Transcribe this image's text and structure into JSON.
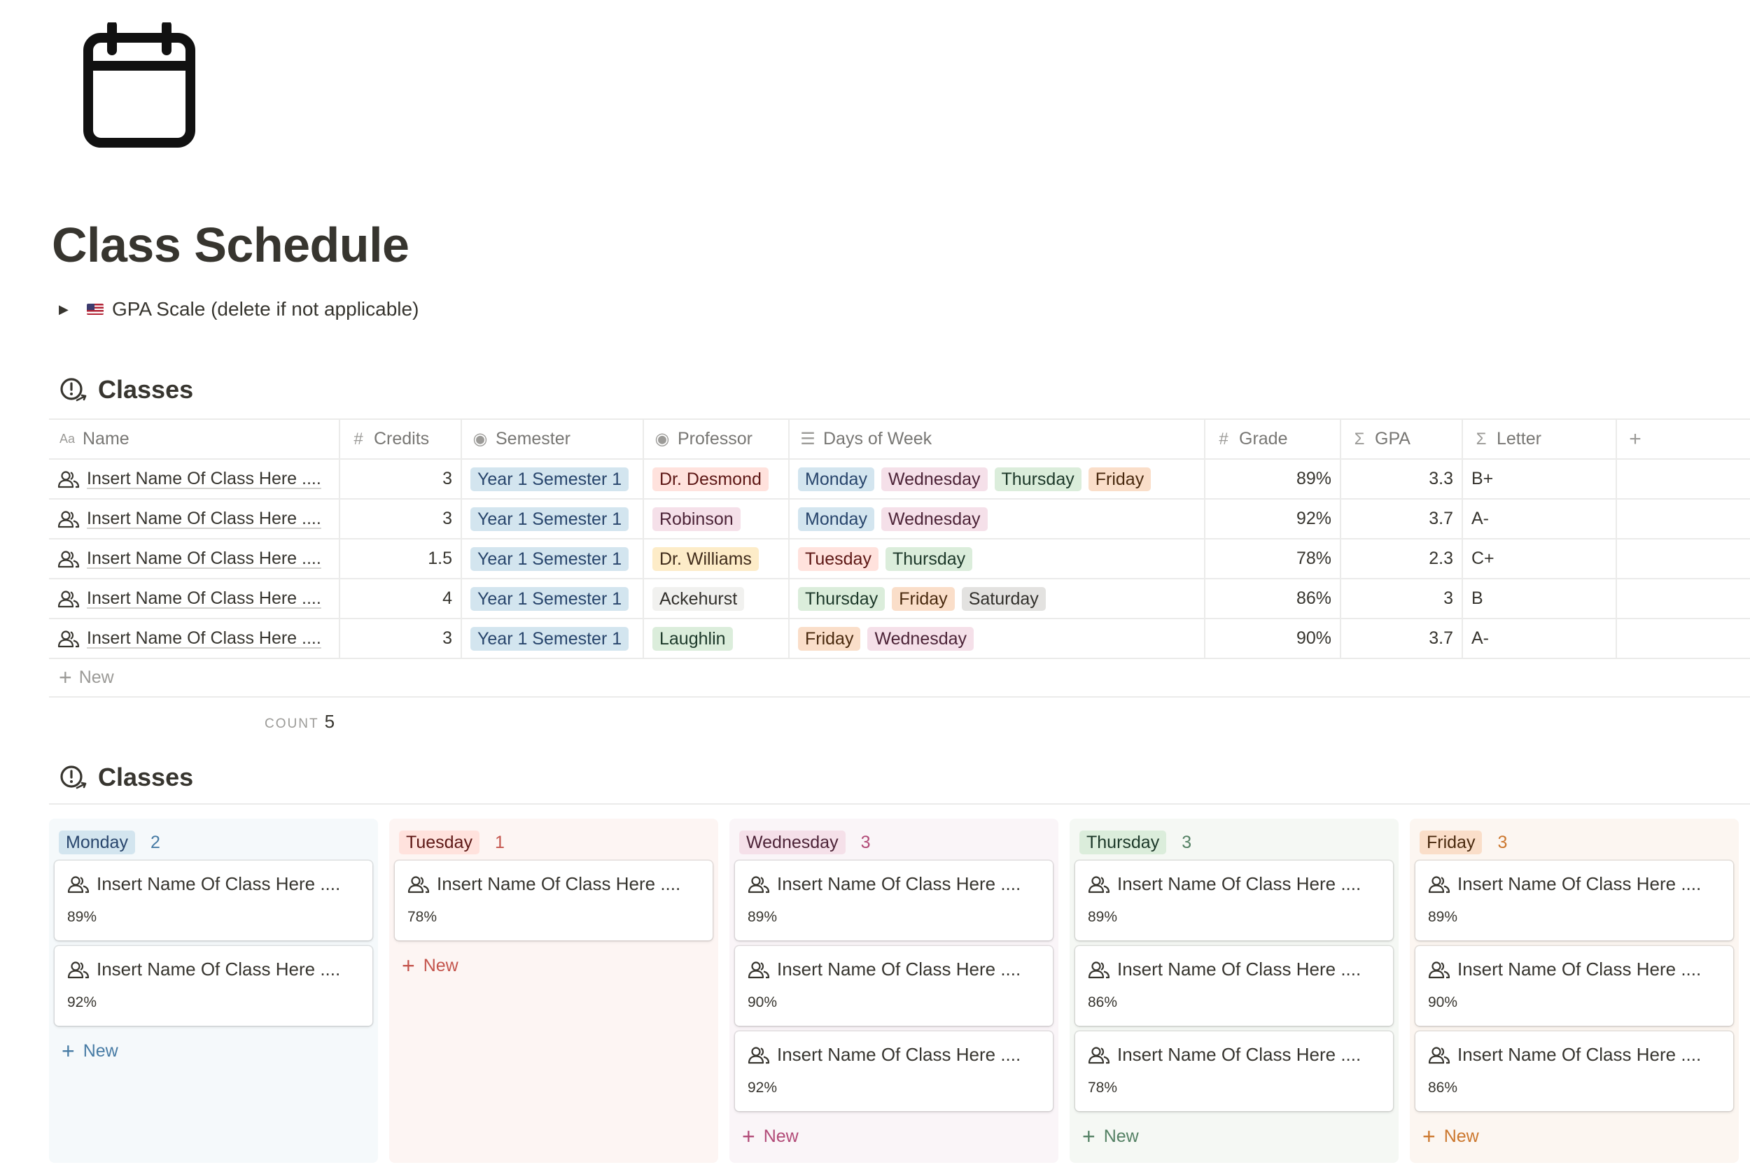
{
  "page": {
    "icon": "calendar-icon",
    "title": "Class Schedule",
    "toggle_label": "GPA Scale (delete if not applicable)"
  },
  "colors": {
    "blue_tag": "#d3e5ef",
    "red_tag": "#ffe2dd",
    "pink_tag": "#f5e0e9",
    "green_tag": "#dbeddb",
    "orange_tag": "#fadec9",
    "yellow_tag": "#fdecc8",
    "gray_tag": "#e3e2e0",
    "default_tag": "#f1f1ef"
  },
  "table": {
    "title": "Classes",
    "headers": {
      "name": "Name",
      "credits": "Credits",
      "semester": "Semester",
      "professor": "Professor",
      "days": "Days of Week",
      "grade": "Grade",
      "gpa": "GPA",
      "letter": "Letter"
    },
    "rows": [
      {
        "name": "Insert Name Of Class Here ....",
        "credits": "3",
        "semester": "Year 1 Semester 1",
        "professor": "Dr. Desmond",
        "days": [
          "Monday",
          "Wednesday",
          "Thursday",
          "Friday"
        ],
        "grade": "89%",
        "gpa": "3.3",
        "letter": "B+"
      },
      {
        "name": "Insert Name Of Class Here ....",
        "credits": "3",
        "semester": "Year 1 Semester 1",
        "professor": "Robinson",
        "days": [
          "Monday",
          "Wednesday"
        ],
        "grade": "92%",
        "gpa": "3.7",
        "letter": "A-"
      },
      {
        "name": "Insert Name Of Class Here ....",
        "credits": "1.5",
        "semester": "Year 1 Semester 1",
        "professor": "Dr. Williams",
        "days": [
          "Tuesday",
          "Thursday"
        ],
        "grade": "78%",
        "gpa": "2.3",
        "letter": "C+"
      },
      {
        "name": "Insert Name Of Class Here ....",
        "credits": "4",
        "semester": "Year 1 Semester 1",
        "professor": "Ackehurst",
        "days": [
          "Thursday",
          "Friday",
          "Saturday"
        ],
        "grade": "86%",
        "gpa": "3",
        "letter": "B"
      },
      {
        "name": "Insert Name Of Class Here ....",
        "credits": "3",
        "semester": "Year 1 Semester 1",
        "professor": "Laughlin",
        "days": [
          "Friday",
          "Wednesday"
        ],
        "grade": "90%",
        "gpa": "3.7",
        "letter": "A-"
      }
    ],
    "new_label": "New",
    "count_label": "COUNT",
    "count_value": "5"
  },
  "board": {
    "title": "Classes",
    "columns": [
      {
        "label": "Monday",
        "count": "2",
        "cards": [
          {
            "name": "Insert Name Of Class Here ....",
            "grade": "89%"
          },
          {
            "name": "Insert Name Of Class Here ....",
            "grade": "92%"
          }
        ],
        "new_label": "New"
      },
      {
        "label": "Tuesday",
        "count": "1",
        "cards": [
          {
            "name": "Insert Name Of Class Here ....",
            "grade": "78%"
          }
        ],
        "new_label": "New"
      },
      {
        "label": "Wednesday",
        "count": "3",
        "cards": [
          {
            "name": "Insert Name Of Class Here ....",
            "grade": "89%"
          },
          {
            "name": "Insert Name Of Class Here ....",
            "grade": "90%"
          },
          {
            "name": "Insert Name Of Class Here ....",
            "grade": "92%"
          }
        ],
        "new_label": "New"
      },
      {
        "label": "Thursday",
        "count": "3",
        "cards": [
          {
            "name": "Insert Name Of Class Here ....",
            "grade": "89%"
          },
          {
            "name": "Insert Name Of Class Here ....",
            "grade": "86%"
          },
          {
            "name": "Insert Name Of Class Here ....",
            "grade": "78%"
          }
        ],
        "new_label": "New"
      },
      {
        "label": "Friday",
        "count": "3",
        "cards": [
          {
            "name": "Insert Name Of Class Here ....",
            "grade": "89%"
          },
          {
            "name": "Insert Name Of Class Here ....",
            "grade": "90%"
          },
          {
            "name": "Insert Name Of Class Here ....",
            "grade": "86%"
          }
        ],
        "new_label": "New"
      }
    ]
  }
}
